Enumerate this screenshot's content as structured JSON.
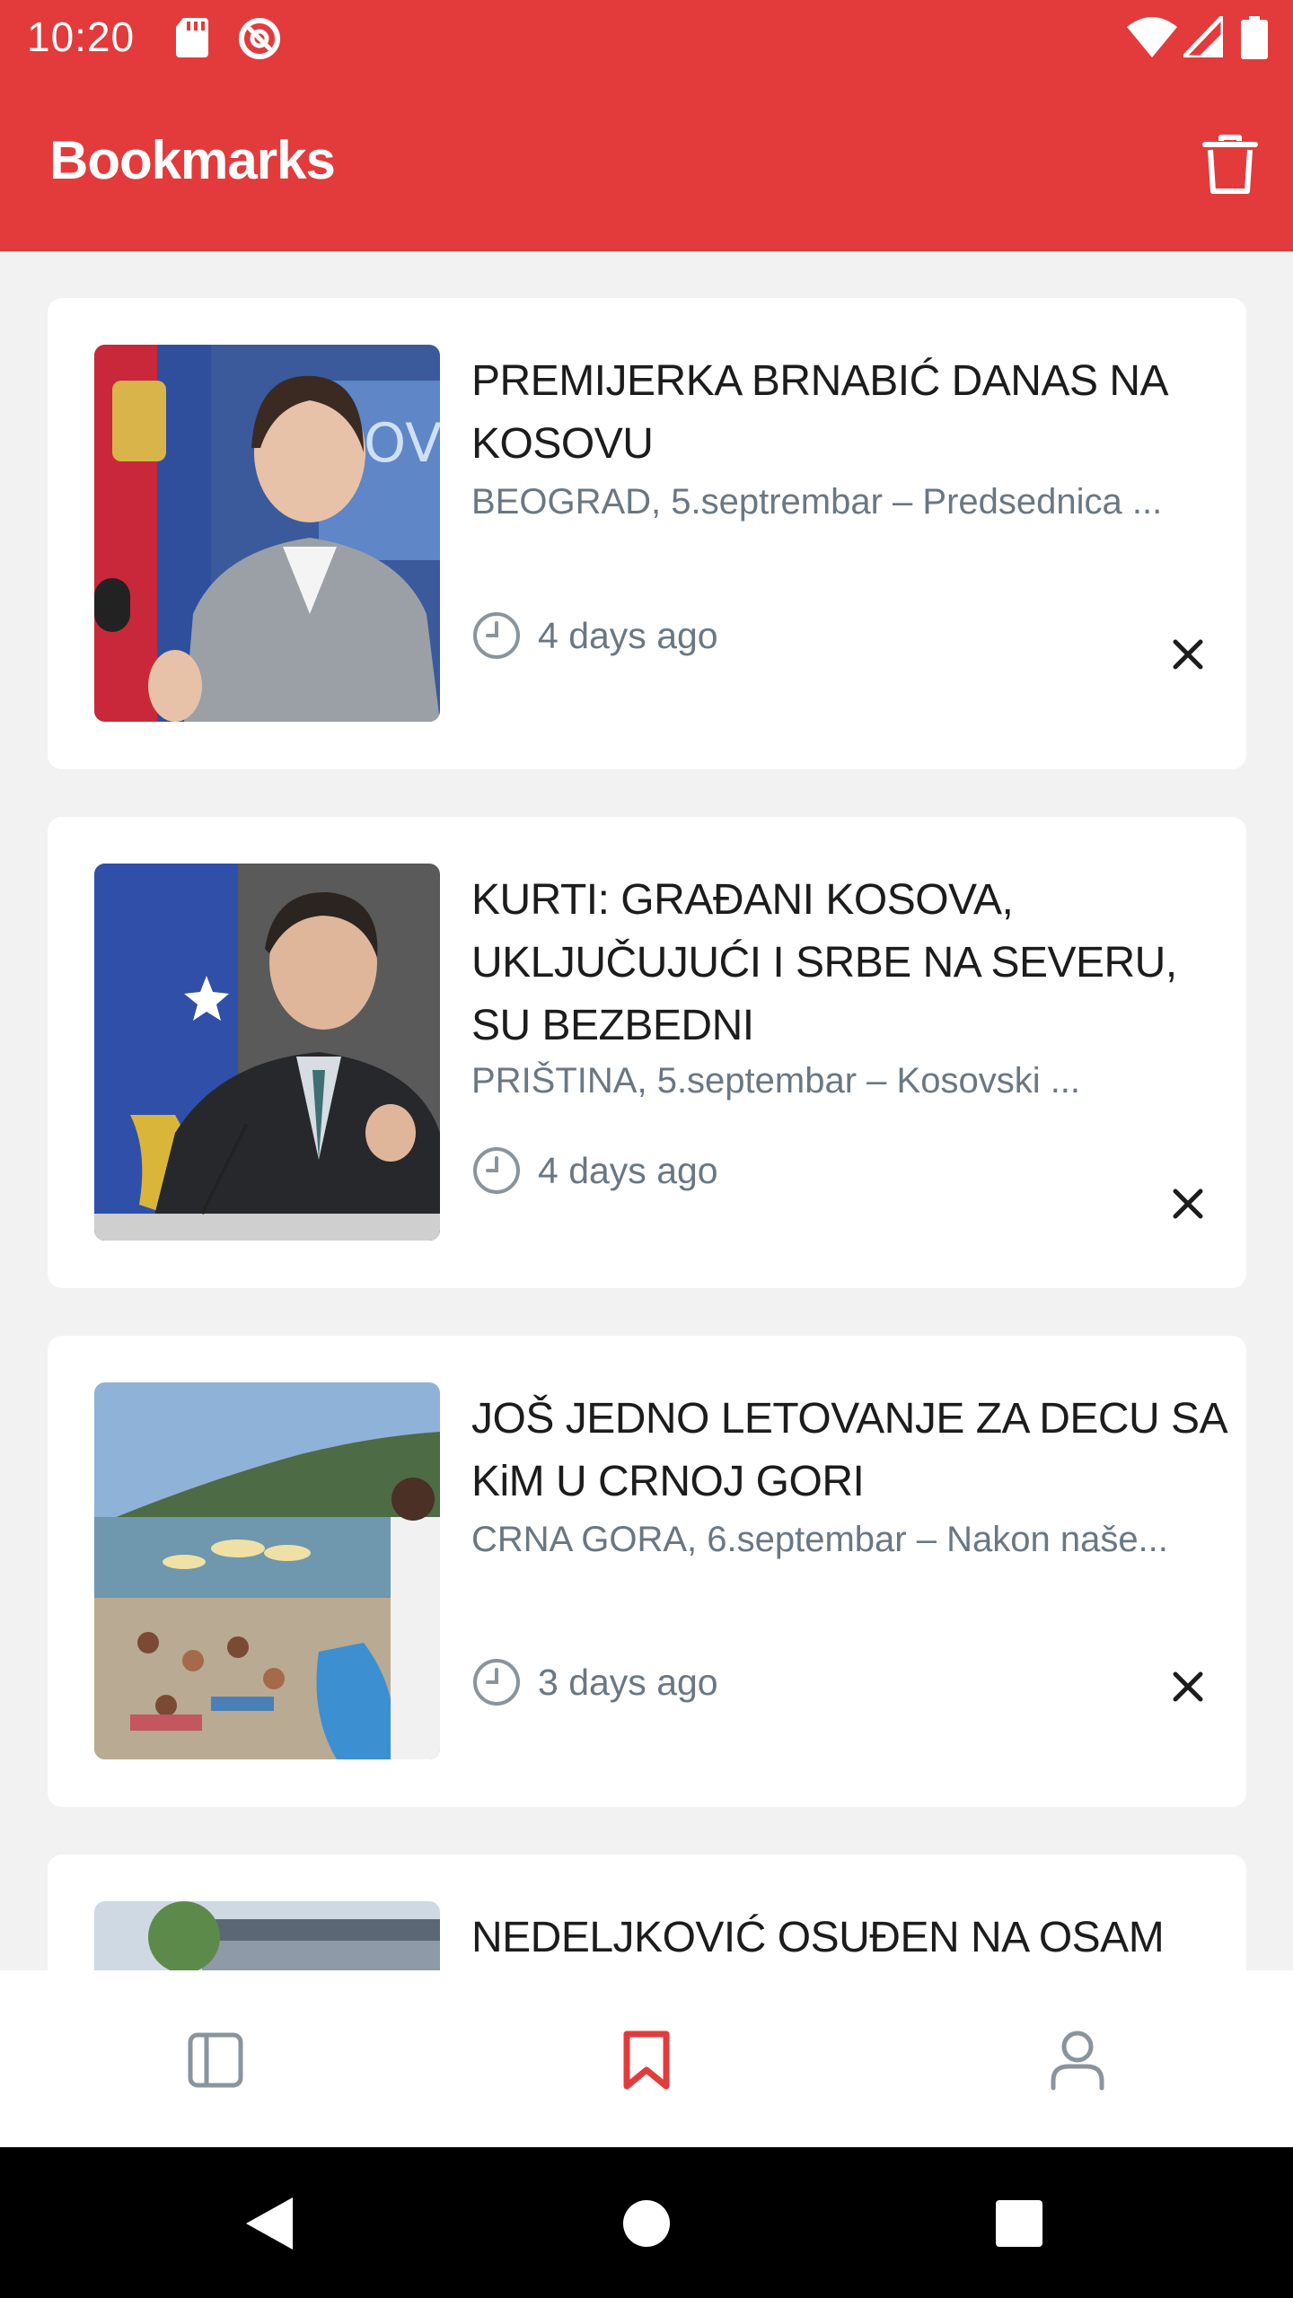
{
  "status_bar": {
    "time": "10:20",
    "icons": [
      "sd-card-icon",
      "at-sign-icon",
      "wifi-icon",
      "signal-icon",
      "battery-icon"
    ]
  },
  "app_bar": {
    "title": "Bookmarks",
    "action_icon": "trash-icon"
  },
  "bookmarks": [
    {
      "title": "PREMIJERKA BRNABIĆ DANAS NA KOSOVU",
      "excerpt": "BEOGRAD, 5.septrembar – Predsednica ...",
      "time_ago": "4 days ago"
    },
    {
      "title": "KURTI: GRAĐANI KOSOVA, UKLJUČUJUĆI I SRBE NA SEVERU, SU BEZBEDNI",
      "excerpt": "PRIŠTINA, 5.septembar – Kosovski ...",
      "time_ago": "4 days ago"
    },
    {
      "title": "JOŠ JEDNO LETOVANJE ZA DECU SA KiM U CRNOJ GORI",
      "excerpt": "CRNA GORA, 6.septembar – Nakon naše...",
      "time_ago": "3 days ago"
    },
    {
      "title": "NEDELJKOVIĆ OSUĐEN NA OSAM"
    }
  ],
  "bottom_nav": {
    "items": [
      "feed-icon",
      "bookmark-icon",
      "profile-icon"
    ],
    "active": "bookmark-icon"
  },
  "colors": {
    "brand": "#e33b3b",
    "background": "#f2f2f2",
    "muted_text": "#6a7783"
  }
}
